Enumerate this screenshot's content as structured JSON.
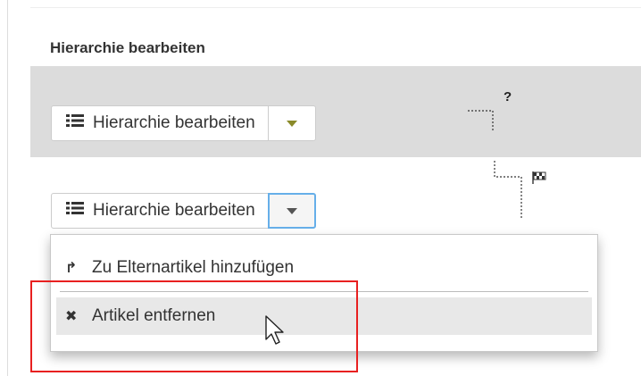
{
  "section": {
    "title": "Hierarchie bearbeiten"
  },
  "rows": [
    {
      "button_label": "Hierarchie bearbeiten",
      "status_icon": "question-mark-icon",
      "status_text": "?"
    },
    {
      "button_label": "Hierarchie bearbeiten",
      "status_icon": "checkered-flag-icon"
    }
  ],
  "dropdown": {
    "items": [
      {
        "icon": "arrow-up-icon",
        "glyph": "↱",
        "label": "Zu Elternartikel hinzufügen"
      },
      {
        "icon": "close-icon",
        "glyph": "✖",
        "label": "Artikel entfernen"
      }
    ]
  },
  "colors": {
    "row_highlight": "#dcdcdc",
    "focus_border": "#66afe9",
    "annotation_red": "#e82020",
    "caret_accent": "#8a8a2a"
  }
}
